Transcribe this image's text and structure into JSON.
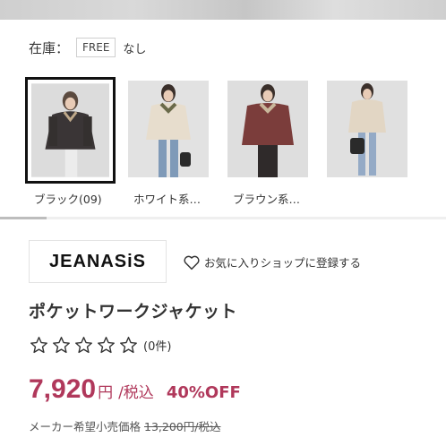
{
  "stock": {
    "label": "在庫：",
    "size": "FREE",
    "status": "なし"
  },
  "colors": [
    {
      "label": "ブラック(09)",
      "jacket": "#3a3536",
      "bottom": "#e6e6e6",
      "bg": "#dcdcdc"
    },
    {
      "label": "ホワイト系…",
      "jacket": "#e7ddcd",
      "bottom": "#7f9ab8",
      "bg": "#e2e2e2"
    },
    {
      "label": "ブラウン系…",
      "jacket": "#7b3d3b",
      "bottom": "#2f2a2a",
      "bg": "#dedede"
    },
    {
      "label": "",
      "jacket": "#e2d6c4",
      "bottom": "#94aac6",
      "bg": "#e0e0e0"
    }
  ],
  "brand": {
    "name": "JEANASiS",
    "favorite_label": "お気に入りショップに登録する"
  },
  "product": {
    "title": "ポケットワークジャケット",
    "review_count": "(0件)",
    "rating": 0,
    "price": "7,920",
    "price_unit": "円",
    "tax": "/税込",
    "discount": "40%OFF",
    "msrp_label": "メーカー希望小売価格",
    "msrp_value": "13,200円/税込"
  },
  "accent_color": "#b0385b"
}
